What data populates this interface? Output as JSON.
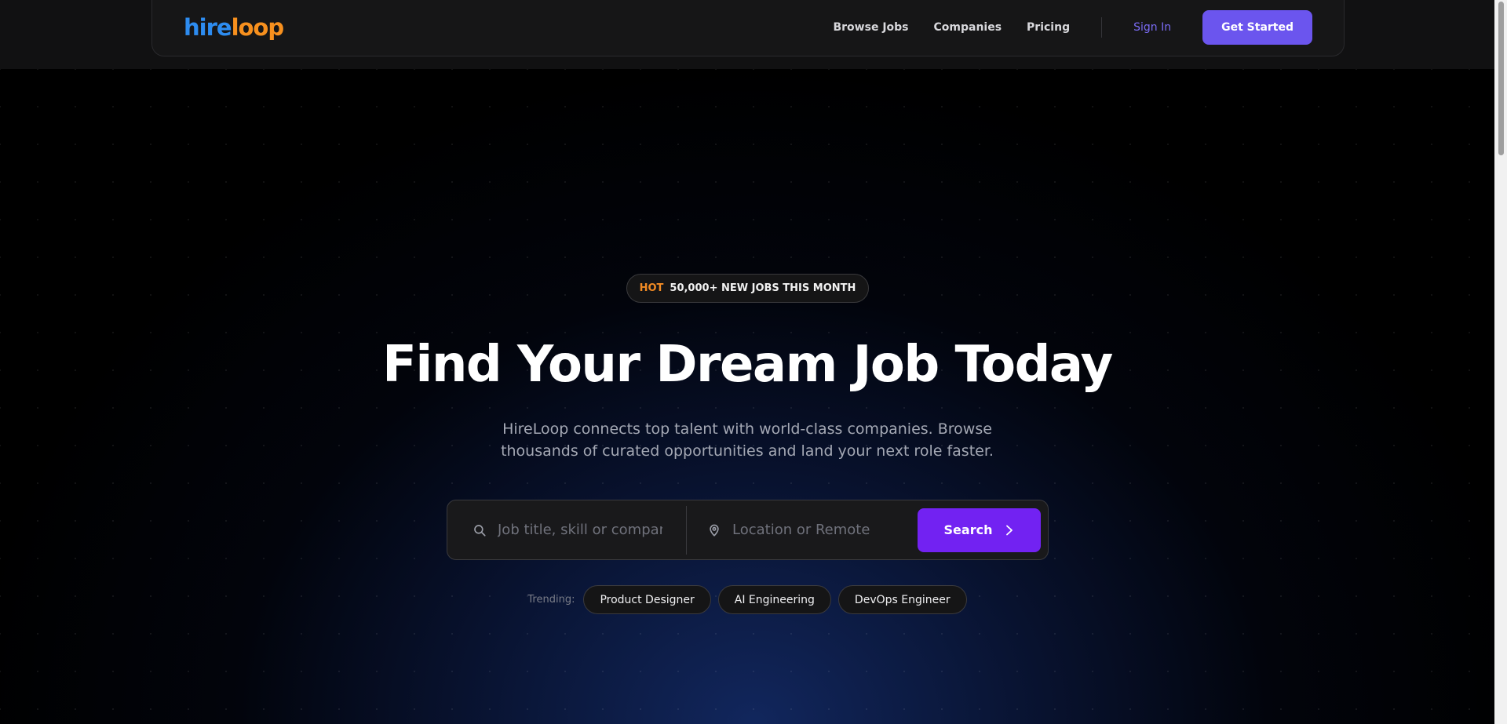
{
  "brand": {
    "part1": "hire",
    "part2": "loop"
  },
  "nav": {
    "links": [
      "Browse Jobs",
      "Companies",
      "Pricing"
    ],
    "sign_in": "Sign In",
    "cta": "Get Started"
  },
  "hero": {
    "badge_hot": "HOT",
    "badge_text": "50,000+ NEW JOBS THIS MONTH",
    "title": "Find Your Dream Job Today",
    "subtitle_line1": "HireLoop connects top talent with world-class companies. Browse",
    "subtitle_line2": "thousands of curated opportunities and land your next role faster."
  },
  "search": {
    "job_placeholder": "Job title, skill or company",
    "location_placeholder": "Location or Remote",
    "button_label": "Search"
  },
  "trending": {
    "label": "Trending:",
    "chips": [
      "Product Designer",
      "AI Engineering",
      "DevOps Engineer"
    ]
  },
  "icons": {
    "search": "search-icon",
    "location": "map-pin-icon",
    "arrow": "chevron-right-icon"
  },
  "colors": {
    "brand_blue": "#2d8cf0",
    "brand_orange": "#f7901e",
    "accent_purple": "#6b55ee",
    "search_purple": "#7222f2",
    "hot_orange": "#f08a24"
  }
}
